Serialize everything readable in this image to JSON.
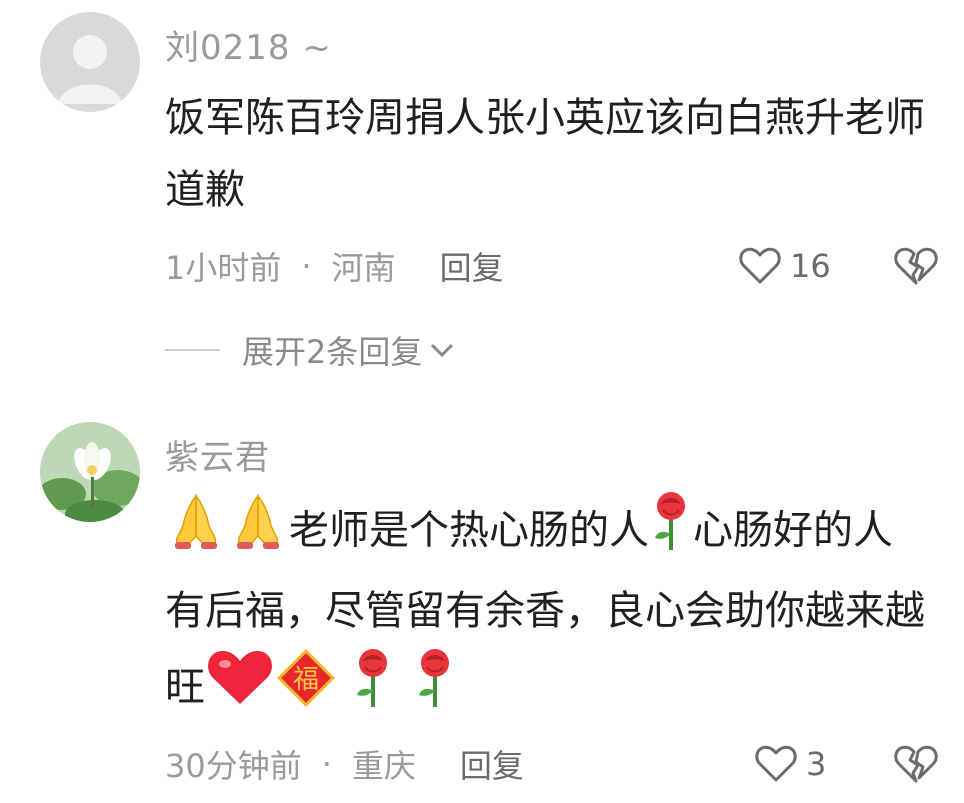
{
  "comments": [
    {
      "username": "刘0218 ~",
      "text": "饭军陈百玲周捐人张小英应该向白燕升老师道歉",
      "time": "1小时前",
      "location": "河南",
      "reply_label": "回复",
      "likes": "16",
      "expand_label": "展开2条回复"
    },
    {
      "username": "紫云君",
      "text_part1": "老师是个热心肠的人",
      "text_part2": "心肠好的人有后福，尽管留有余香，良心会助你越来越旺",
      "time": "30分钟前",
      "location": "重庆",
      "reply_label": "回复",
      "likes": "3",
      "emoji": [
        "praying-hands",
        "praying-hands",
        "rose",
        "red-heart",
        "fu-charm",
        "rose",
        "rose"
      ],
      "fu_char": "福"
    }
  ],
  "colors": {
    "meta": "#9a9a9a",
    "text": "#202020",
    "avatar_default": "#d9d9d9"
  }
}
